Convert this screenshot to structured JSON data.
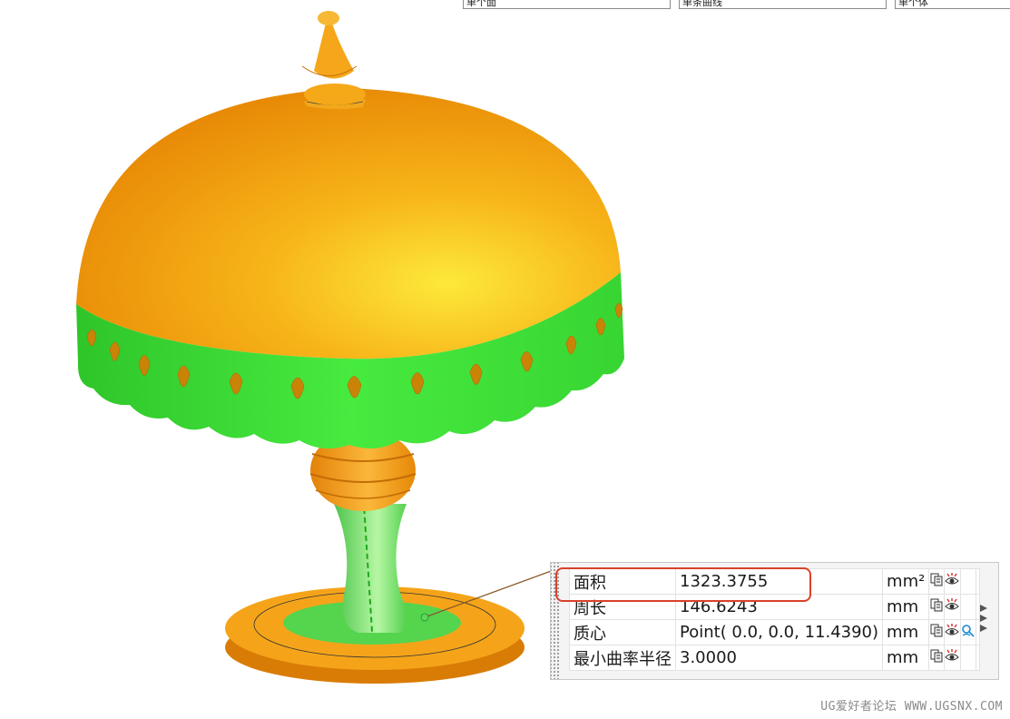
{
  "toolbar_fields": [
    "单个面",
    "单条曲线",
    "单个体"
  ],
  "properties": [
    {
      "label": "面积",
      "value": "1323.3755",
      "unit": "mm²",
      "highlighted": true,
      "extra_icon": false
    },
    {
      "label": "周长",
      "value": "146.6243",
      "unit": "mm",
      "highlighted": false,
      "extra_icon": false
    },
    {
      "label": "质心",
      "value": "Point( 0.0, 0.0, 11.4390)",
      "unit": "mm",
      "highlighted": false,
      "extra_icon": true
    },
    {
      "label": "最小曲率半径",
      "value": "3.0000",
      "unit": "mm",
      "highlighted": false,
      "extra_icon": false
    }
  ],
  "colors": {
    "lamp_body": "#f39b0b",
    "selected_face": "#3fe33a",
    "highlight_box": "#d9412a",
    "leader_line": "#8a5a2b"
  },
  "icons": [
    "copy-icon",
    "show-icon",
    "measure-icon",
    "more-arrow-icon"
  ],
  "watermark": "UG爱好者论坛 WWW.UGSNX.COM"
}
